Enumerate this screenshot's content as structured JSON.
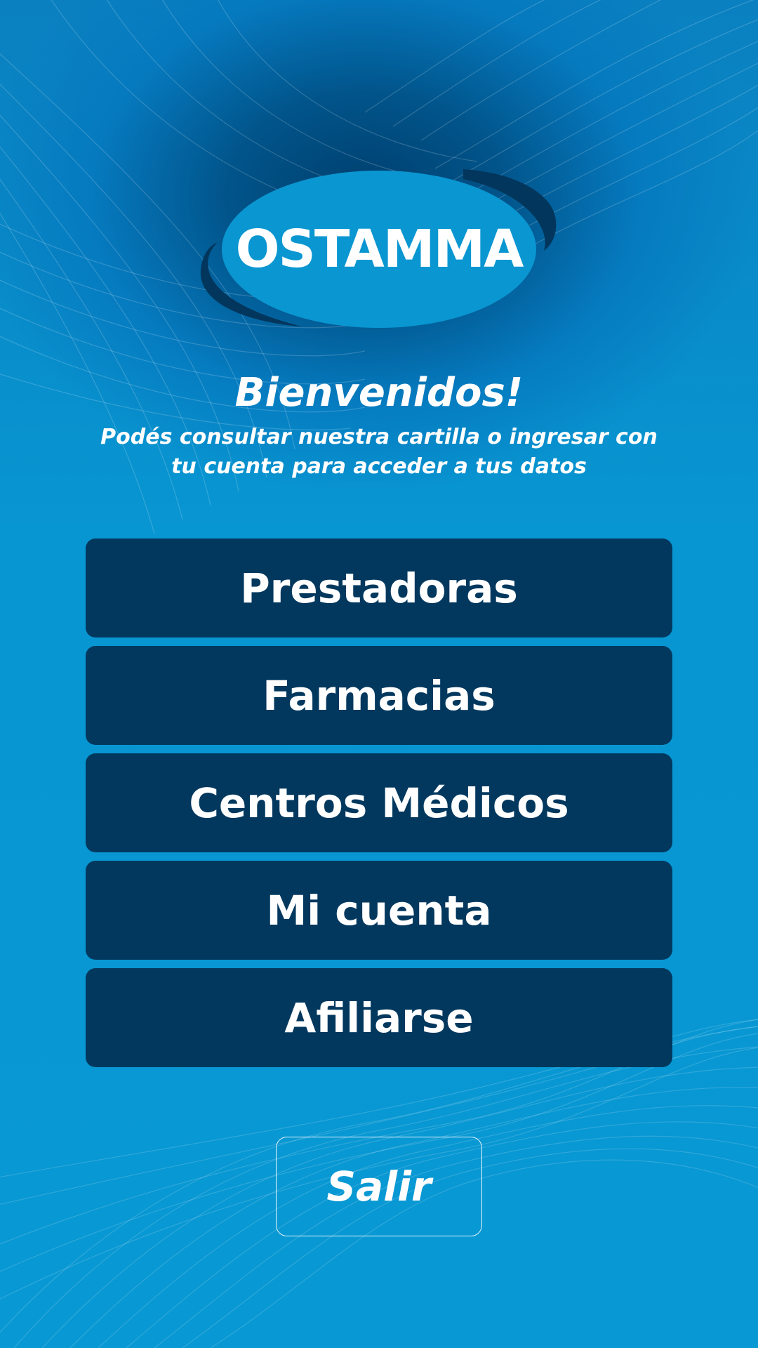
{
  "app": {
    "logo_text": "OSTAMMA"
  },
  "welcome": {
    "title": "Bienvenidos!",
    "subtitle": "Podés consultar nuestra cartilla o ingresar con tu cuenta para acceder a tus datos"
  },
  "menu": {
    "items": [
      {
        "label": "Prestadoras"
      },
      {
        "label": "Farmacias"
      },
      {
        "label": "Centros Médicos"
      },
      {
        "label": "Mi cuenta"
      },
      {
        "label": "Afiliarse"
      }
    ]
  },
  "exit": {
    "label": "Salir"
  },
  "colors": {
    "background": "#0897d0",
    "background_dark": "#003f6e",
    "button": "#02385e",
    "logo_ellipse": "#0a96d1",
    "logo_swoosh": "#03365c",
    "text": "#ffffff"
  }
}
